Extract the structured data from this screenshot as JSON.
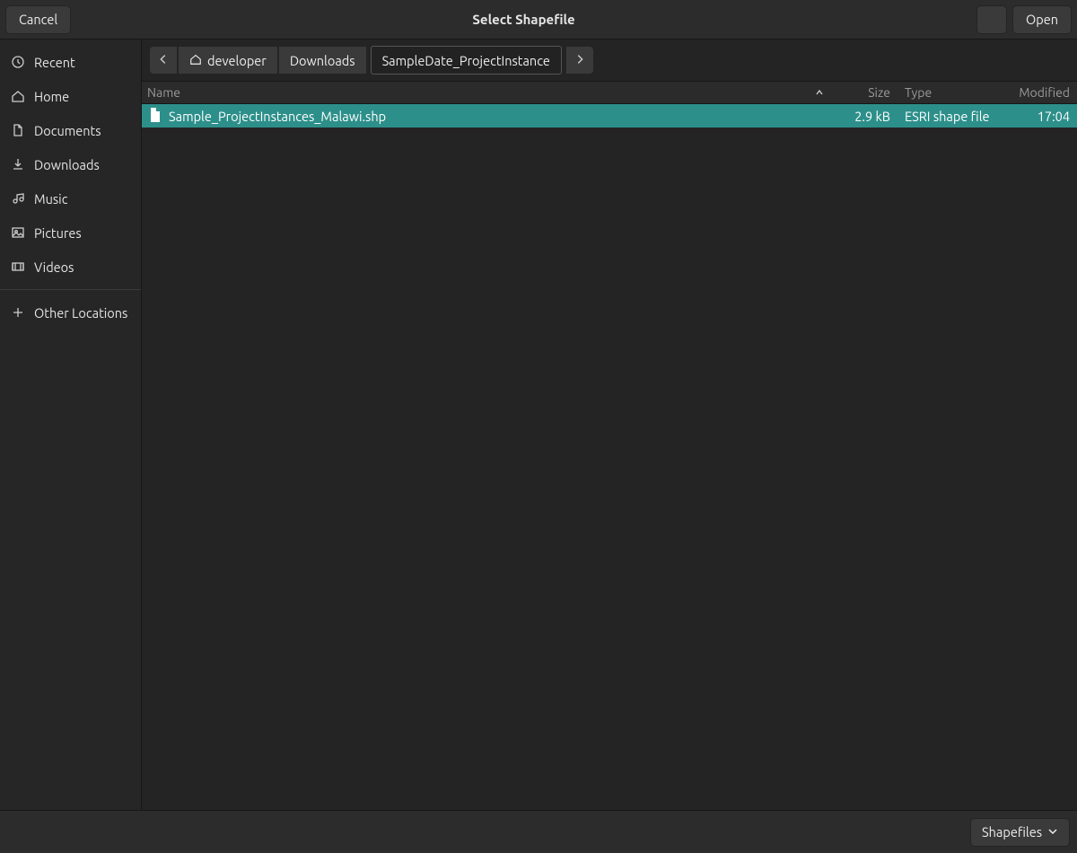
{
  "header": {
    "cancel": "Cancel",
    "title": "Select Shapefile",
    "open": "Open"
  },
  "sidebar": {
    "items": [
      {
        "icon": "clock",
        "label": "Recent"
      },
      {
        "icon": "home",
        "label": "Home"
      },
      {
        "icon": "doc",
        "label": "Documents"
      },
      {
        "icon": "download",
        "label": "Downloads"
      },
      {
        "icon": "music",
        "label": "Music"
      },
      {
        "icon": "picture",
        "label": "Pictures"
      },
      {
        "icon": "video",
        "label": "Videos"
      }
    ],
    "other": {
      "icon": "plus",
      "label": "Other Locations"
    }
  },
  "breadcrumb": {
    "segments": [
      {
        "label": "developer",
        "home": true
      },
      {
        "label": "Downloads"
      },
      {
        "label": "SampleDate_ProjectInstance",
        "current": true
      }
    ]
  },
  "columns": {
    "name": "Name",
    "size": "Size",
    "type": "Type",
    "modified": "Modified"
  },
  "files": [
    {
      "name": "Sample_ProjectInstances_Malawi.shp",
      "size": "2.9 kB",
      "type": "ESRI shape file",
      "modified": "17:04",
      "selected": true
    }
  ],
  "footer": {
    "filter": "Shapefiles"
  }
}
